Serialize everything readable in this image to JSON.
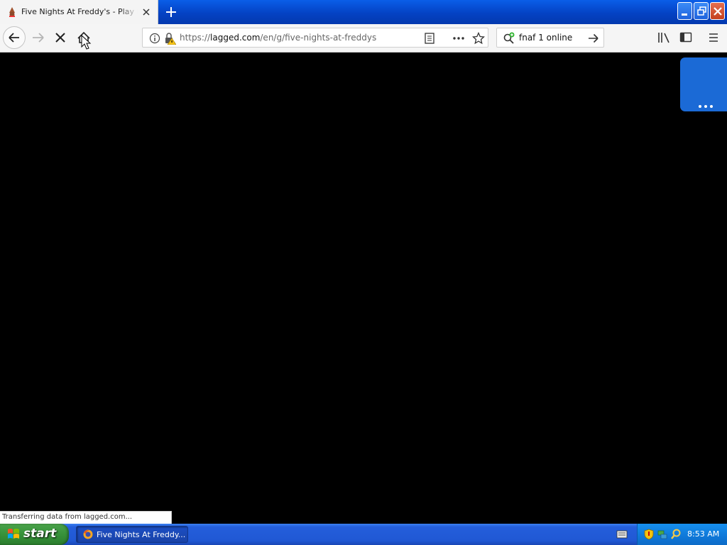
{
  "browser": {
    "tab": {
      "title": "Five Nights At Freddy's - Play Five Nights At Freddy's Online",
      "favicon": "freddy-favicon-icon"
    },
    "new_tab_icon": "plus-icon",
    "window_controls": [
      "minimize-icon",
      "restore-icon",
      "close-icon"
    ],
    "nav": {
      "back_icon": "arrow-left-icon",
      "forward_icon": "arrow-right-icon",
      "stop_icon": "x-icon",
      "home_icon": "house-icon"
    },
    "url": {
      "scheme": "https://",
      "host": "lagged.com",
      "path": "/en/g/five-nights-at-freddys"
    },
    "search": {
      "value": "fnaf 1 online"
    },
    "toolbar_icons": [
      "library-icon",
      "sidebar-icon",
      "hamburger-menu-icon"
    ]
  },
  "page": {
    "background": "#000000",
    "side_tab_color": "#1b6ad6"
  },
  "status": {
    "text": "Transferring data from lagged.com..."
  },
  "taskbar": {
    "start_label": "start",
    "task_label": "Five Nights At Freddy...",
    "clock": "8:53 AM"
  }
}
